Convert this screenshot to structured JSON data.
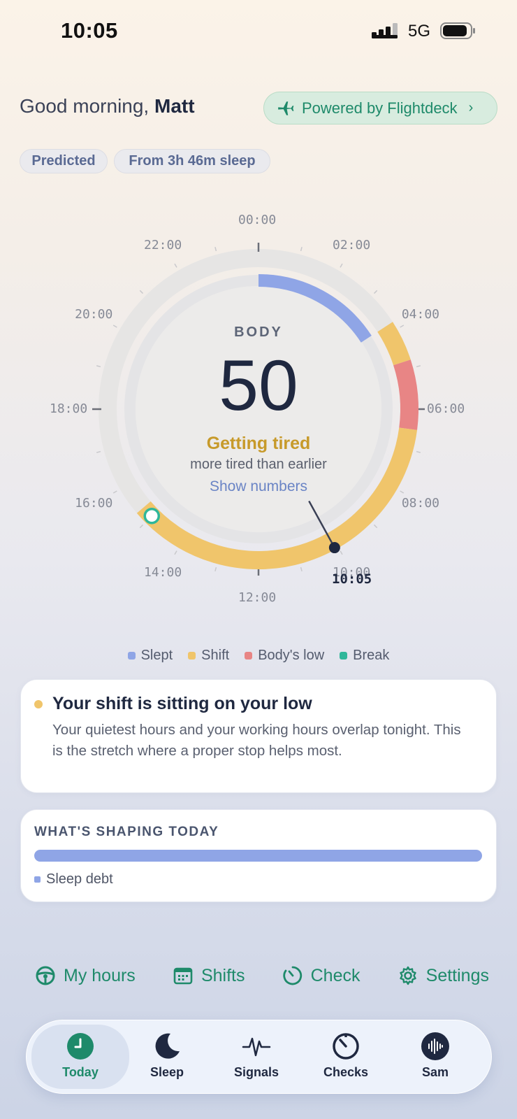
{
  "status_bar": {
    "time": "10:05",
    "network": "5G"
  },
  "header": {
    "greeting": "Good morning,",
    "name": "Matt",
    "powered_label": "Powered by Flightdeck"
  },
  "chips": {
    "predicted": "Predicted",
    "sleep": "From 3h 46m sleep"
  },
  "dial": {
    "hour_labels": [
      "00:00",
      "02:00",
      "04:00",
      "06:00",
      "08:00",
      "10:00",
      "12:00",
      "14:00",
      "16:00",
      "18:00",
      "20:00",
      "22:00"
    ],
    "now_label": "10:05",
    "body_label": "BODY",
    "score": "50",
    "state": "Getting tired",
    "subtitle": "more tired than earlier",
    "show_numbers": "Show numbers",
    "segments": [
      {
        "kind": "slept",
        "from_hour": 0.0,
        "to_hour": 3.8
      },
      {
        "kind": "shift",
        "from_hour": 3.8,
        "to_hour": 4.8
      },
      {
        "kind": "low",
        "from_hour": 4.8,
        "to_hour": 6.5
      },
      {
        "kind": "shift",
        "from_hour": 6.5,
        "to_hour": 15.3
      }
    ],
    "break_hour": 15.0,
    "now_hour": 10.08
  },
  "legend": {
    "items": [
      {
        "label": "Slept",
        "color": "#8fa5e6"
      },
      {
        "label": "Shift",
        "color": "#f0c56b"
      },
      {
        "label": "Body's low",
        "color": "#e88585"
      },
      {
        "label": "Break",
        "color": "#2fb79a"
      }
    ]
  },
  "alert": {
    "title": "Your shift is sitting on your low",
    "text": "Your quietest hours and your working hours overlap tonight. This is the stretch where a proper stop helps most."
  },
  "shaping": {
    "title": "WHAT'S SHAPING TODAY",
    "item": "Sleep debt",
    "share": 1.0
  },
  "actions": {
    "my_hours": "My hours",
    "shifts": "Shifts",
    "check": "Check",
    "settings": "Settings"
  },
  "tabs": {
    "today": "Today",
    "sleep": "Sleep",
    "signals": "Signals",
    "checks": "Checks",
    "sam": "Sam"
  },
  "colors": {
    "accent": "#1e8a6a",
    "slept": "#8fa5e6",
    "shift": "#f0c56b",
    "low": "#e88585",
    "break": "#2fb79a"
  }
}
